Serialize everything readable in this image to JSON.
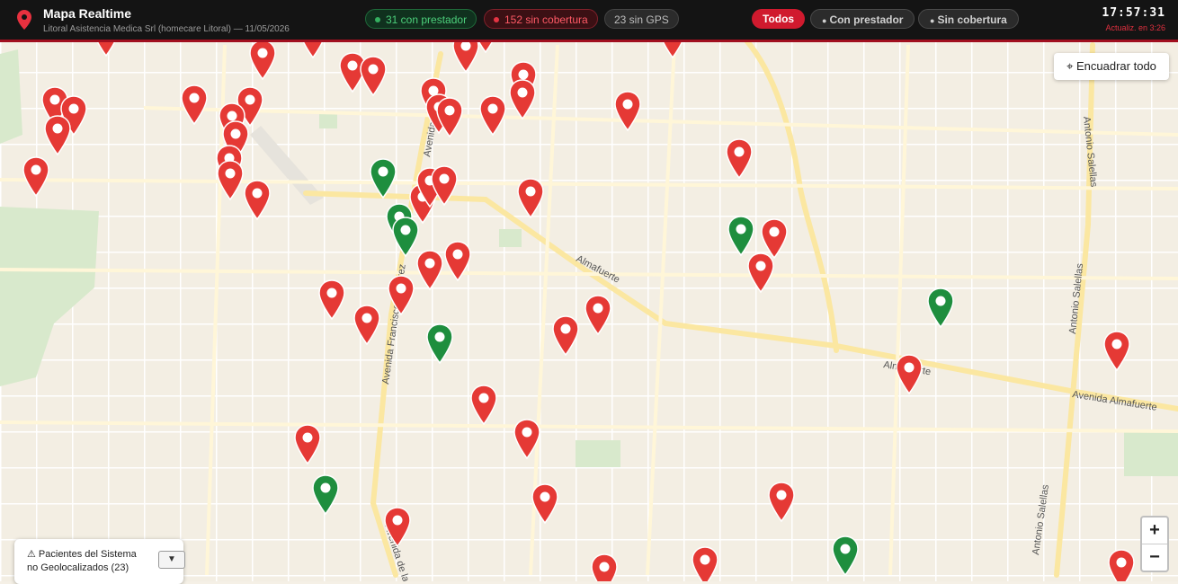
{
  "header": {
    "title": "Mapa Realtime",
    "subtitle": "Litoral Asistencia Medica Srl (homecare Litoral) — 11/05/2026",
    "stats": {
      "with_provider": "31 con prestador",
      "without_coverage": "152 sin cobertura",
      "no_gps": "23 sin GPS"
    },
    "filters": {
      "all": "Todos",
      "with_provider": "Con prestador",
      "without_coverage": "Sin cobertura",
      "bullet": "●"
    },
    "clock": "17:57:31",
    "update_note": "Actualiz. en 3:26"
  },
  "colors": {
    "accent": "#d01a2e",
    "pin_red": "#e53935",
    "pin_green": "#1e8e3e",
    "topbar": "#141414"
  },
  "map_controls": {
    "fit_all": "⌖ Encuadrar todo",
    "zoom_in": "+",
    "zoom_out": "−"
  },
  "no_gps_panel": {
    "text": "⚠ Pacientes del Sistema no Geolocalizados (23)",
    "toggle": "▼"
  },
  "street_labels": [
    {
      "name": "Avenida Ramírez",
      "text": "Avenida Ramírez"
    },
    {
      "name": "Almafuerte",
      "text": "Almafuerte"
    },
    {
      "name": "Avenida Francisco Ramírez",
      "text": "Avenida Francisco Ramírez"
    },
    {
      "name": "Antonio Salellas",
      "text": "Antonio Salellas"
    },
    {
      "name": "Avenida Almafuerte",
      "text": "Avenida Almafuerte"
    },
    {
      "name": "Almafuerte east",
      "text": "Almafuerte"
    },
    {
      "name": "Avenida de las Américas",
      "text": "Avenida de la"
    }
  ],
  "markers": {
    "with_provider_visible": 8,
    "without_coverage_visible": 53
  }
}
